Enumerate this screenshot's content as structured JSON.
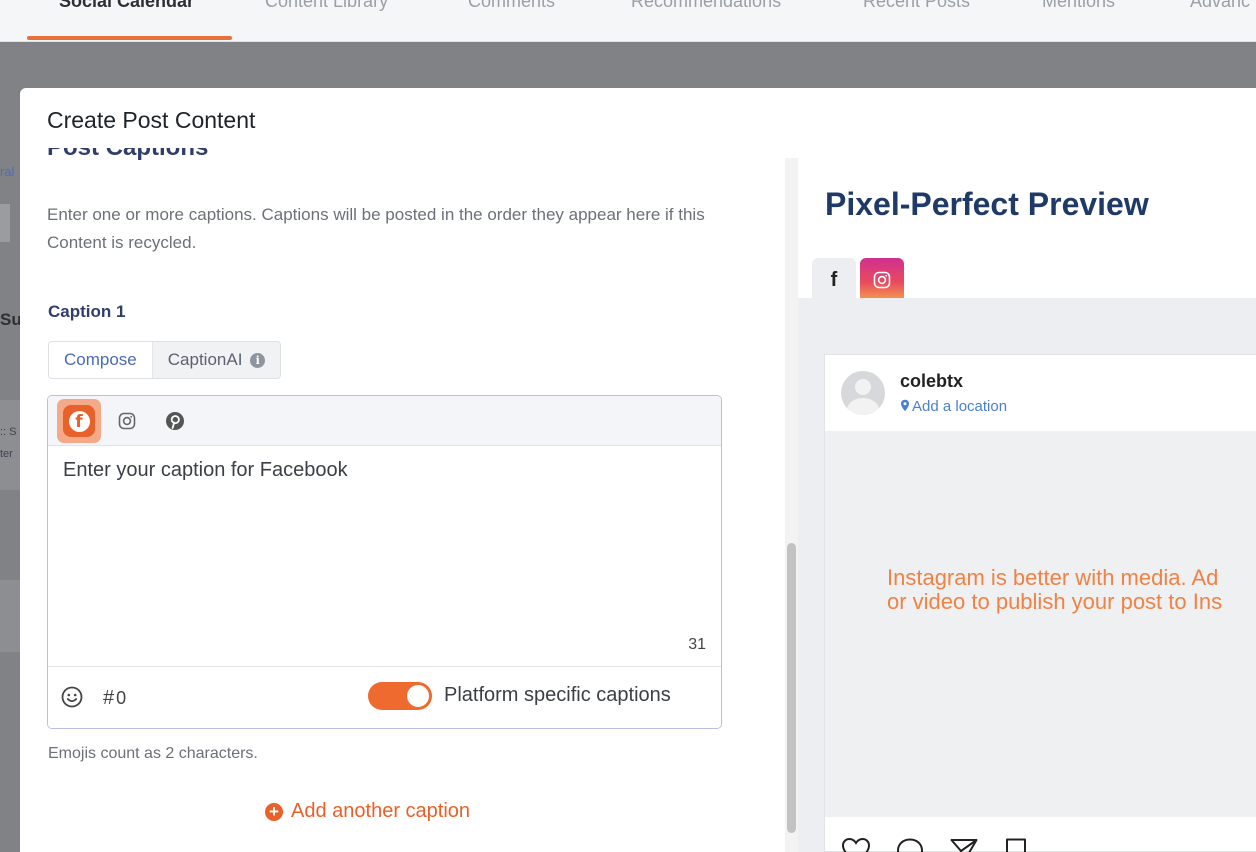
{
  "top_nav": {
    "tabs": [
      "Social Calendar",
      "Content Library",
      "Comments",
      "Recommendations",
      "Recent Posts",
      "Mentions",
      "Advanc"
    ],
    "active_index": 0
  },
  "background": {
    "fragments": [
      "ral",
      "Su",
      ":: S",
      "ter"
    ]
  },
  "modal": {
    "title": "Create Post Content",
    "section_title": "Post Captions",
    "intro": "Enter one or more captions. Captions will be posted in the order they appear here if this Content is recycled.",
    "caption_label": "Caption 1",
    "tabs": {
      "compose": "Compose",
      "caption_ai": "CaptionAI",
      "info_glyph": "i"
    },
    "platforms": [
      "facebook-icon",
      "instagram-icon",
      "pinterest-icon"
    ],
    "fb_glyph": "f",
    "caption_placeholder": "Enter your caption for Facebook",
    "char_count": "31",
    "hashtag_glyph": "#",
    "hashtag_count": "0",
    "platform_specific_label": "Platform specific captions",
    "platform_specific_on": true,
    "emoji_note": "Emojis count as 2 characters.",
    "add_caption_glyph": "+",
    "add_caption": "Add another caption"
  },
  "preview": {
    "title": "Pixel-Perfect Preview",
    "fb_tab_glyph": "f",
    "username": "colebtx",
    "location": "Add a location",
    "media_message_line1": "Instagram is better with media. Ad",
    "media_message_line2": "or video to publish your post to Ins"
  },
  "colors": {
    "accent_orange": "#e8612a",
    "navy": "#1f3a66",
    "link_blue": "#4a7fd0"
  }
}
